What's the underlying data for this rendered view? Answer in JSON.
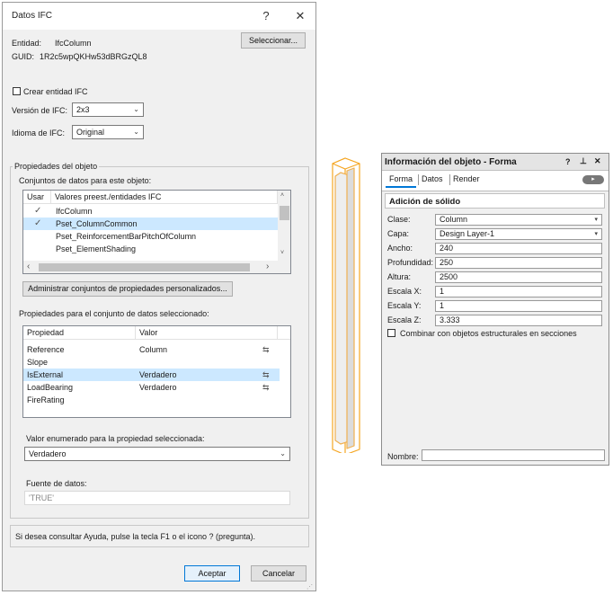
{
  "dialog": {
    "title": "Datos IFC",
    "help_glyph": "?",
    "close_glyph": "✕",
    "entity_label": "Entidad:",
    "entity_value": "IfcColumn",
    "guid_label": "GUID:",
    "guid_value": "1R2c5wpQKHw53dBRGzQL8",
    "select_button": "Seleccionar...",
    "create_ifc_label": "Crear entidad IFC",
    "ifc_version_label": "Versión de IFC:",
    "ifc_version_value": "2x3",
    "ifc_language_label": "Idioma de IFC:",
    "ifc_language_value": "Original",
    "object_props_group": "Propiedades del objeto",
    "datasets_label": "Conjuntos de datos para este objeto:",
    "datasets_columns": [
      "Usar",
      "Valores preest./entidades IFC"
    ],
    "datasets_rows": [
      {
        "name": "IfcColumn",
        "checked": true,
        "selected": false
      },
      {
        "name": "Pset_ColumnCommon",
        "checked": true,
        "selected": true
      },
      {
        "name": "Pset_ReinforcementBarPitchOfColumn",
        "checked": false,
        "selected": false
      },
      {
        "name": "Pset_ElementShading",
        "checked": false,
        "selected": false
      }
    ],
    "manage_button": "Administrar conjuntos de propiedades personalizados...",
    "props_label": "Propiedades para el conjunto de datos seleccionado:",
    "props_columns": [
      "Propiedad",
      "Valor"
    ],
    "props_rows": [
      {
        "property": "Reference",
        "value": "Column",
        "has_icon": true,
        "selected": false
      },
      {
        "property": "Slope",
        "value": "",
        "has_icon": false,
        "selected": false
      },
      {
        "property": "IsExternal",
        "value": "Verdadero",
        "has_icon": true,
        "selected": true
      },
      {
        "property": "LoadBearing",
        "value": "Verdadero",
        "has_icon": true,
        "selected": false
      },
      {
        "property": "FireRating",
        "value": "",
        "has_icon": false,
        "selected": false
      }
    ],
    "enum_label": "Valor enumerado para la propiedad seleccionada:",
    "enum_value": "Verdadero",
    "source_label": "Fuente de datos:",
    "source_value": "'TRUE'",
    "help_text": "Si desea consultar Ayuda, pulse la tecla F1 o el icono ? (pregunta).",
    "ok_button": "Aceptar",
    "cancel_button": "Cancelar"
  },
  "oip": {
    "title": "Información del objeto - Forma",
    "title_icons": [
      "?",
      "⊥",
      "✕"
    ],
    "tabs": [
      "Forma",
      "Datos",
      "Render"
    ],
    "section": "Adición de sólido",
    "fields": [
      {
        "label": "Clase:",
        "value": "Column",
        "dropdown": true
      },
      {
        "label": "Capa:",
        "value": "Design Layer-1",
        "dropdown": true
      },
      {
        "label": "Ancho:",
        "value": "240",
        "dropdown": false
      },
      {
        "label": "Profundidad:",
        "value": "250",
        "dropdown": false
      },
      {
        "label": "Altura:",
        "value": "2500",
        "dropdown": false
      },
      {
        "label": "Escala X:",
        "value": "1",
        "dropdown": false
      },
      {
        "label": "Escala Y:",
        "value": "1",
        "dropdown": false
      },
      {
        "label": "Escala Z:",
        "value": "3.333",
        "dropdown": false
      }
    ],
    "combine_label": "Combinar con objetos estructurales en secciones",
    "name_label": "Nombre:",
    "name_value": ""
  },
  "colors": {
    "selection": "#cce8ff",
    "accent": "#0078d7",
    "column_outline": "#f5a623"
  }
}
